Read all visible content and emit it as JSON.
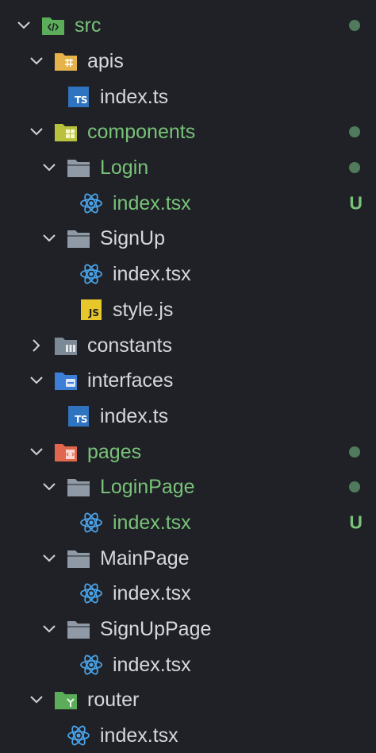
{
  "explorer": {
    "items": [
      {
        "label": "src",
        "kind": "folder",
        "folder_icon": "src-folder-icon",
        "icon_color": "#5cad59",
        "git": true,
        "dot": true
      },
      {
        "label": "apis",
        "kind": "folder",
        "folder_icon": "api-folder-icon",
        "icon_color": "#e6b24a",
        "git": false
      },
      {
        "label": "index.ts",
        "kind": "file",
        "file_icon": "typescript-icon",
        "git": false
      },
      {
        "label": "components",
        "kind": "folder",
        "folder_icon": "components-folder-icon",
        "icon_color": "#b9c23d",
        "git": true,
        "dot": true
      },
      {
        "label": "Login",
        "kind": "folder",
        "folder_icon": "folder-icon",
        "icon_color": "#8f9aa6",
        "git": true,
        "dot": true
      },
      {
        "label": "index.tsx",
        "kind": "file",
        "file_icon": "react-icon",
        "git": true,
        "badge": "U"
      },
      {
        "label": "SignUp",
        "kind": "folder",
        "folder_icon": "folder-icon",
        "icon_color": "#8f9aa6",
        "git": false
      },
      {
        "label": "index.tsx",
        "kind": "file",
        "file_icon": "react-icon",
        "git": false
      },
      {
        "label": "style.js",
        "kind": "file",
        "file_icon": "javascript-icon",
        "git": false
      },
      {
        "label": "constants",
        "kind": "folder",
        "folder_icon": "constants-folder-icon",
        "icon_color": "#7c8996",
        "git": false
      },
      {
        "label": "interfaces",
        "kind": "folder",
        "folder_icon": "interfaces-folder-icon",
        "icon_color": "#3d7fd6",
        "git": false
      },
      {
        "label": "index.ts",
        "kind": "file",
        "file_icon": "typescript-icon",
        "git": false
      },
      {
        "label": "pages",
        "kind": "folder",
        "folder_icon": "pages-folder-icon",
        "icon_color": "#e0674d",
        "git": true,
        "dot": true
      },
      {
        "label": "LoginPage",
        "kind": "folder",
        "folder_icon": "folder-icon",
        "icon_color": "#8f9aa6",
        "git": true,
        "dot": true
      },
      {
        "label": "index.tsx",
        "kind": "file",
        "file_icon": "react-icon",
        "git": true,
        "badge": "U"
      },
      {
        "label": "MainPage",
        "kind": "folder",
        "folder_icon": "folder-icon",
        "icon_color": "#8f9aa6",
        "git": false
      },
      {
        "label": "index.tsx",
        "kind": "file",
        "file_icon": "react-icon",
        "git": false
      },
      {
        "label": "SignUpPage",
        "kind": "folder",
        "folder_icon": "folder-icon",
        "icon_color": "#8f9aa6",
        "git": false
      },
      {
        "label": "index.tsx",
        "kind": "file",
        "file_icon": "react-icon",
        "git": false
      },
      {
        "label": "router",
        "kind": "folder",
        "folder_icon": "router-folder-icon",
        "icon_color": "#5cad59",
        "git": false
      },
      {
        "label": "index.tsx",
        "kind": "file",
        "file_icon": "react-icon",
        "git": false
      }
    ],
    "colors": {
      "background": "#1f2126",
      "text": "#d5d8dc",
      "git_modified": "#79c279",
      "git_dot": "#4f7a5c",
      "chevron": "#d0d3d7",
      "typescript": "#2f74c0",
      "javascript": "#e8c72a",
      "react": "#4aa3e8"
    }
  }
}
